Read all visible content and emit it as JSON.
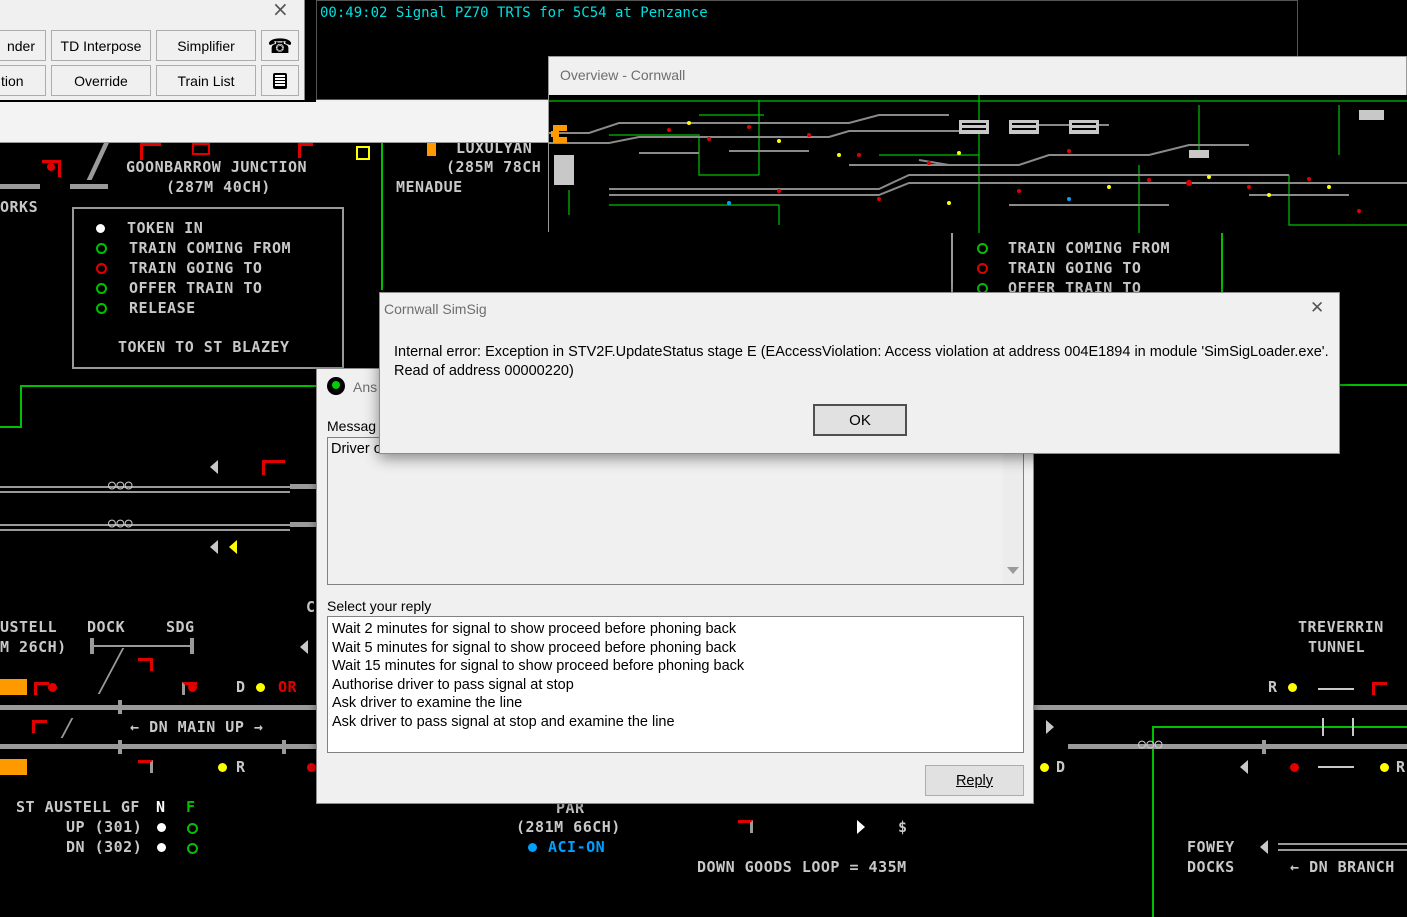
{
  "message_bar": {
    "text": "00:49:02 Signal PZ70 TRTS for 5C54 at Penzance"
  },
  "toolbar": {
    "buttons_row1": [
      "nder",
      "TD Interpose",
      "Simplifier"
    ],
    "buttons_row2": [
      "tion",
      "Override",
      "Train List"
    ],
    "phone_icon": "telephone-icon",
    "print_icon": "printer-icon",
    "close_label": "×"
  },
  "overview": {
    "title": "Overview - Cornwall"
  },
  "error_dialog": {
    "title": "Cornwall SimSig",
    "close_label": "✕",
    "message_line1": "Internal error: Exception in STV2F.UpdateStatus stage E (EAccessViolation: Access violation at address 004E1894 in module 'SimSigLoader.exe'.",
    "message_line2": "Read of address 00000220)",
    "ok_label": "OK"
  },
  "answer_dialog": {
    "title": "Ans",
    "message_label": "Messag",
    "message_text": "Driver o",
    "reply_label": "Select your reply",
    "replies": [
      "Wait 2 minutes for signal to show proceed before phoning back",
      "Wait 5 minutes for signal to show proceed before phoning back",
      "Wait 15 minutes for signal to show proceed before phoning back",
      "Authorise driver to pass signal at stop",
      "Ask driver to examine the line",
      "Ask driver to pass signal at stop and examine the line"
    ],
    "reply_button": "Reply"
  },
  "layout_labels": {
    "goonbarrow": "GOONBARROW JUNCTION",
    "goonbarrow_mileage": "(287M 40CH)",
    "luxulyan": "LUXULYAN",
    "luxulyan_mileage": "(285M 78CH",
    "menadue": "MENADUE",
    "works": "ORKS",
    "token_box": {
      "items": [
        "TOKEN IN",
        "TRAIN COMING FROM",
        "TRAIN GOING TO",
        "OFFER TRAIN TO",
        "RELEASE"
      ],
      "footer": "TOKEN TO ST BLAZEY"
    },
    "right_token_box": {
      "items": [
        "TRAIN COMING FROM",
        "TRAIN GOING TO",
        "OFFER TRAIN TO"
      ]
    },
    "austell": "USTELL",
    "austell_mileage": "M 26CH)",
    "dock": "DOCK",
    "sdg": "SDG",
    "dn_main_up": "DN MAIN UP",
    "st_austell_gf": "ST AUSTELL GF",
    "gf_n": "N",
    "gf_f": "F",
    "gf_up": "UP (301)",
    "gf_dn": "DN (302)",
    "par": "PAR",
    "par_mileage": "(281M 66CH)",
    "aci_on": "ACI-ON",
    "down_goods_loop": "DOWN GOODS LOOP = 435M",
    "treverrin": "TREVERRIN",
    "tunnel": "TUNNEL",
    "fowey": "FOWEY",
    "docks": "DOCKS",
    "dn_branch": "DN BRANCH",
    "dollar": "$",
    "c_char": "C",
    "sig_r1": "R",
    "sig_d1": "D",
    "sig_or": "OR",
    "sig_r2": "R",
    "sig_d2": "D",
    "sig_r3": "R",
    "sig_r4": "R"
  },
  "colors": {
    "track": "#9a9a9a",
    "green": "#00c000",
    "red": "#e00000",
    "yellow": "#ffff00",
    "orange": "#ff9900",
    "cyan": "#00a0ff"
  }
}
